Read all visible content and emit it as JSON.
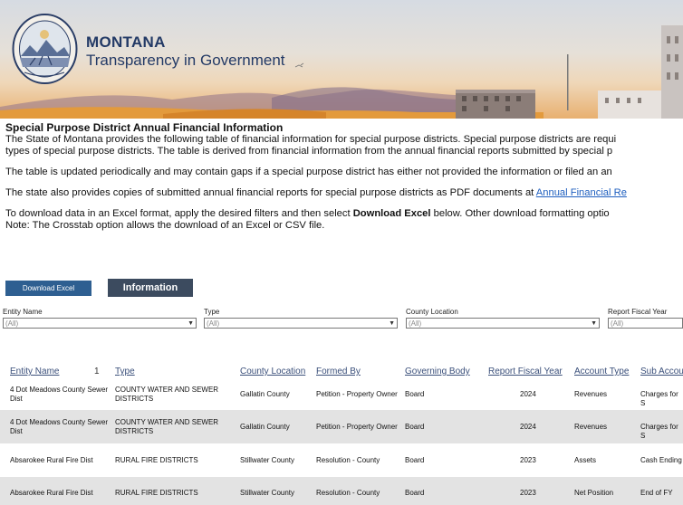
{
  "header": {
    "brand_line1": "MONTANA",
    "brand_line2": "Transparency in Government"
  },
  "intro": {
    "title": "Special Purpose District Annual Financial Information",
    "p1_line1": "The State of Montana provides the following table of financial information for special purpose districts. Special purpose districts are requi",
    "p1_line2": "types of special purpose districts. The table is derived from financial information from the annual financial reports submitted by special p",
    "p2": "The table is updated periodically and may contain gaps if a special purpose district has either not provided the information or filed an an",
    "p3_text": "The state also provides copies of submitted annual financial reports for special purpose districts as PDF documents at",
    "p3_link": "Annual Financial Re",
    "p4_pre": "To download data in an Excel format, apply the desired filters and then select",
    "p4_bold": "Download Excel",
    "p4_post": "below.  Other download formatting optio",
    "p5": "Note: The Crosstab option allows the download of an Excel or CSV file."
  },
  "buttons": {
    "download": "Download Excel",
    "information": "Information"
  },
  "filters": [
    {
      "label": "Entity Name",
      "value": "(All)"
    },
    {
      "label": "Type",
      "value": "(All)"
    },
    {
      "label": "County Location",
      "value": "(All)"
    },
    {
      "label": "Report Fiscal Year",
      "value": "(All)"
    }
  ],
  "table": {
    "columns": [
      "Entity Name",
      "Type",
      "County Location",
      "Formed By",
      "Governing Body",
      "Report Fiscal Year",
      "Account Type",
      "Sub Accou"
    ],
    "sort_indicator": "1",
    "rows": [
      {
        "entity": [
          "4 Dot Meadows County Sewer",
          "Dist"
        ],
        "type": [
          "COUNTY WATER AND SEWER",
          "DISTRICTS"
        ],
        "county": "Gallatin County",
        "formed": "Petition - Property Owner",
        "body": "Board",
        "year": "2024",
        "account": "Revenues",
        "sub": "Charges for S"
      },
      {
        "entity": [
          "4 Dot Meadows County Sewer",
          "Dist"
        ],
        "type": [
          "COUNTY WATER AND SEWER",
          "DISTRICTS"
        ],
        "county": "Gallatin County",
        "formed": "Petition - Property Owner",
        "body": "Board",
        "year": "2024",
        "account": "Revenues",
        "sub": "Charges for S"
      },
      {
        "entity": [
          "Absarokee Rural Fire Dist",
          ""
        ],
        "type": [
          "RURAL FIRE DISTRICTS",
          ""
        ],
        "county": "Stillwater County",
        "formed": "Resolution - County",
        "body": "Board",
        "year": "2023",
        "account": "Assets",
        "sub": "Cash Ending"
      },
      {
        "entity": [
          "Absarokee Rural Fire Dist",
          ""
        ],
        "type": [
          "RURAL FIRE DISTRICTS",
          ""
        ],
        "county": "Stillwater County",
        "formed": "Resolution - County",
        "body": "Board",
        "year": "2023",
        "account": "Net Position",
        "sub": "End of FY"
      }
    ]
  }
}
